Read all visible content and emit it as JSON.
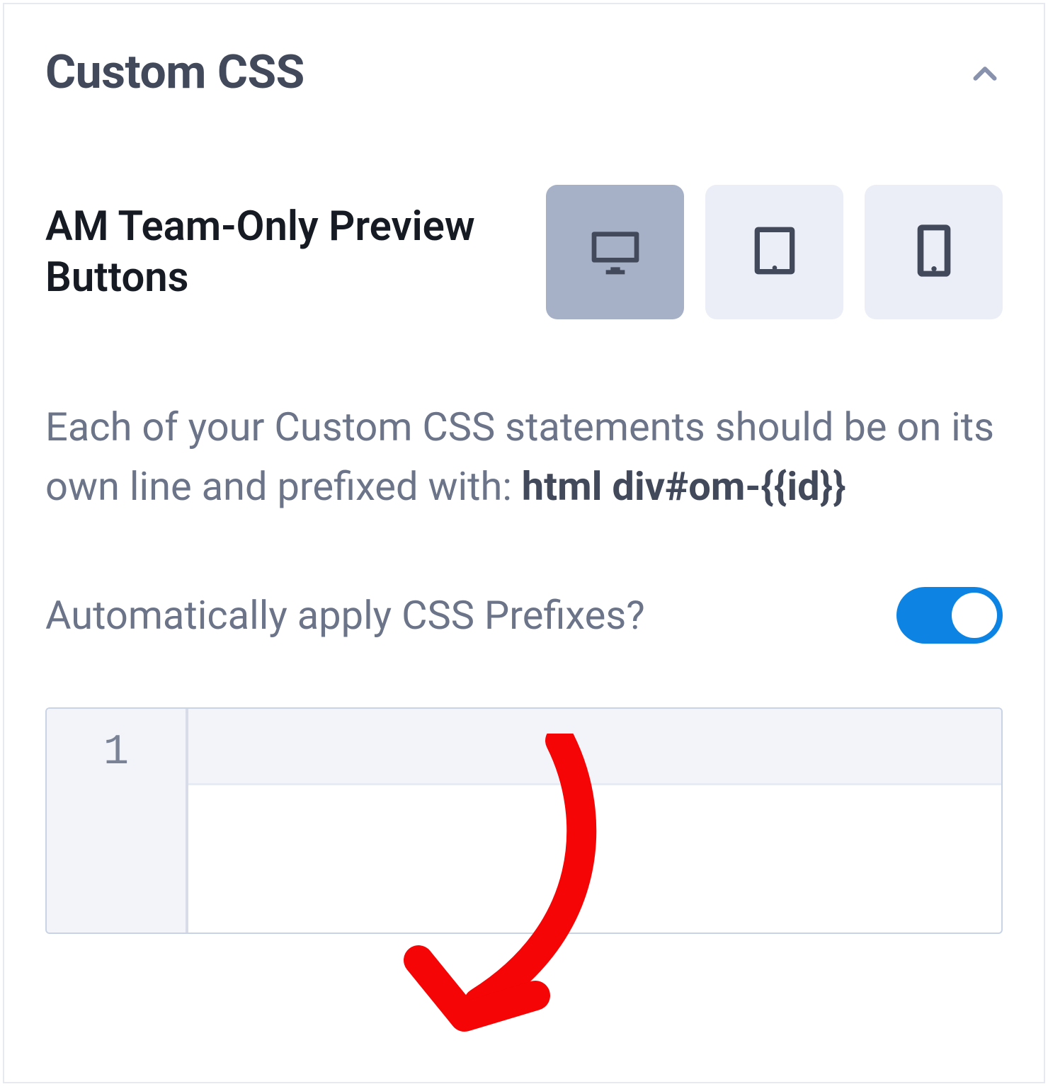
{
  "header": {
    "title": "Custom CSS"
  },
  "preview": {
    "label": "AM Team-Only Preview Buttons",
    "devices": [
      "desktop",
      "tablet",
      "mobile"
    ],
    "active": "desktop"
  },
  "help": {
    "text_prefix": "Each of your Custom CSS statements should be on its own line and prefixed with: ",
    "text_bold": "html div#om-{{id}}"
  },
  "toggle": {
    "label": "Automatically apply CSS Prefixes?",
    "value": true
  },
  "editor": {
    "line_numbers": [
      "1"
    ]
  },
  "colors": {
    "accent": "#0d84e3",
    "text_primary": "#41495b",
    "text_muted": "#6b7488",
    "button_bg": "#ebeef6",
    "button_active_bg": "#a6b0c6",
    "annotation": "#f50505"
  }
}
